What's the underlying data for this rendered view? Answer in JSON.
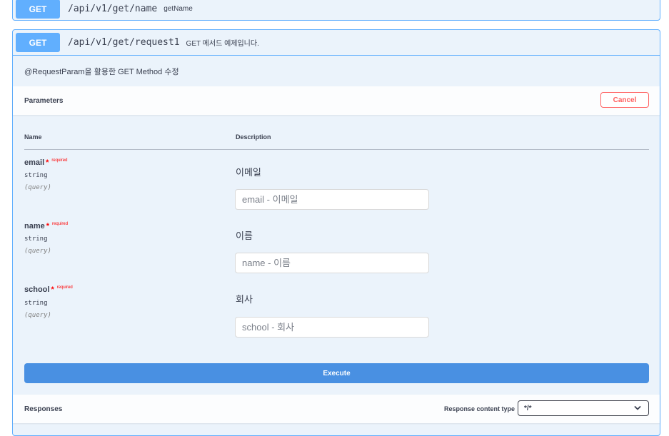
{
  "previous_endpoint": {
    "method": "GET",
    "path": "/api/v1/get/name",
    "summary": "getName"
  },
  "endpoint": {
    "method": "GET",
    "path": "/api/v1/get/request1",
    "summary": "GET 메서드 예제입니다.",
    "description": "@RequestParam을 활용한 GET Method 수정"
  },
  "parameters": {
    "title": "Parameters",
    "cancel_label": "Cancel",
    "col_name": "Name",
    "col_description": "Description",
    "items": [
      {
        "name": "email",
        "star": "*",
        "required": "required",
        "type": "string",
        "in": "(query)",
        "description": "이메일",
        "placeholder": "email - 이메일"
      },
      {
        "name": "name",
        "star": "*",
        "required": "required",
        "type": "string",
        "in": "(query)",
        "description": "이름",
        "placeholder": "name - 이름"
      },
      {
        "name": "school",
        "star": "*",
        "required": "required",
        "type": "string",
        "in": "(query)",
        "description": "회사",
        "placeholder": "school - 회사"
      }
    ],
    "execute_label": "Execute"
  },
  "responses": {
    "title": "Responses",
    "content_type_label": "Response content type",
    "content_type_value": "*/*"
  },
  "icons": {
    "select": "chevron-down-icon"
  },
  "colors": {
    "get": "#61affe",
    "execute": "#4990e2",
    "cancel": "#ff6060"
  }
}
